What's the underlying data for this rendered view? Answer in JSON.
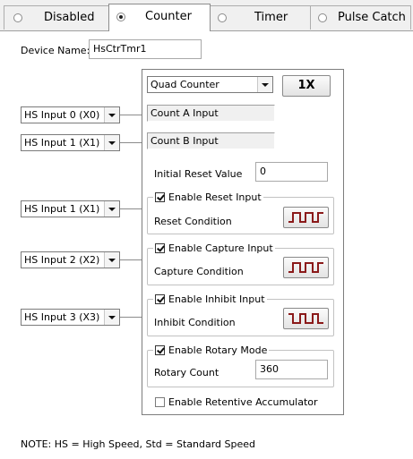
{
  "tabs": [
    {
      "label": "Disabled",
      "selected": false
    },
    {
      "label": "Counter",
      "selected": true
    },
    {
      "label": "Timer",
      "selected": false
    },
    {
      "label": "Pulse Catch",
      "selected": false
    }
  ],
  "device": {
    "label": "Device Name:",
    "value": "HsCtrTmr1"
  },
  "mode": {
    "selected": "Quad Counter",
    "multiplier_label": "1X"
  },
  "inputs": {
    "count_a": {
      "select": "HS Input 0 (X0)",
      "label": "Count A Input"
    },
    "count_b": {
      "select": "HS Input 1 (X1)",
      "label": "Count B Input"
    },
    "reset": {
      "select": "HS Input 1 (X1)"
    },
    "capture": {
      "select": "HS Input 2 (X2)"
    },
    "inhibit": {
      "select": "HS Input 3 (X3)"
    }
  },
  "initial_reset": {
    "label": "Initial Reset Value",
    "value": "0"
  },
  "reset_group": {
    "check_label": "Enable Reset Input",
    "checked": true,
    "condition_label": "Reset Condition",
    "wave_icon": "rising-edge-pulse-icon"
  },
  "capture_group": {
    "check_label": "Enable Capture Input",
    "checked": true,
    "condition_label": "Capture Condition",
    "wave_icon": "rising-edge-pulse-icon"
  },
  "inhibit_group": {
    "check_label": "Enable Inhibit Input",
    "checked": true,
    "condition_label": "Inhibit Condition",
    "wave_icon": "falling-edge-pulse-icon"
  },
  "rotary_group": {
    "check_label": "Enable Rotary Mode",
    "checked": true,
    "count_label": "Rotary Count",
    "count_value": "360"
  },
  "retentive": {
    "label": "Enable Retentive Accumulator",
    "checked": false
  },
  "note": "NOTE: HS = High Speed, Std = Standard Speed"
}
